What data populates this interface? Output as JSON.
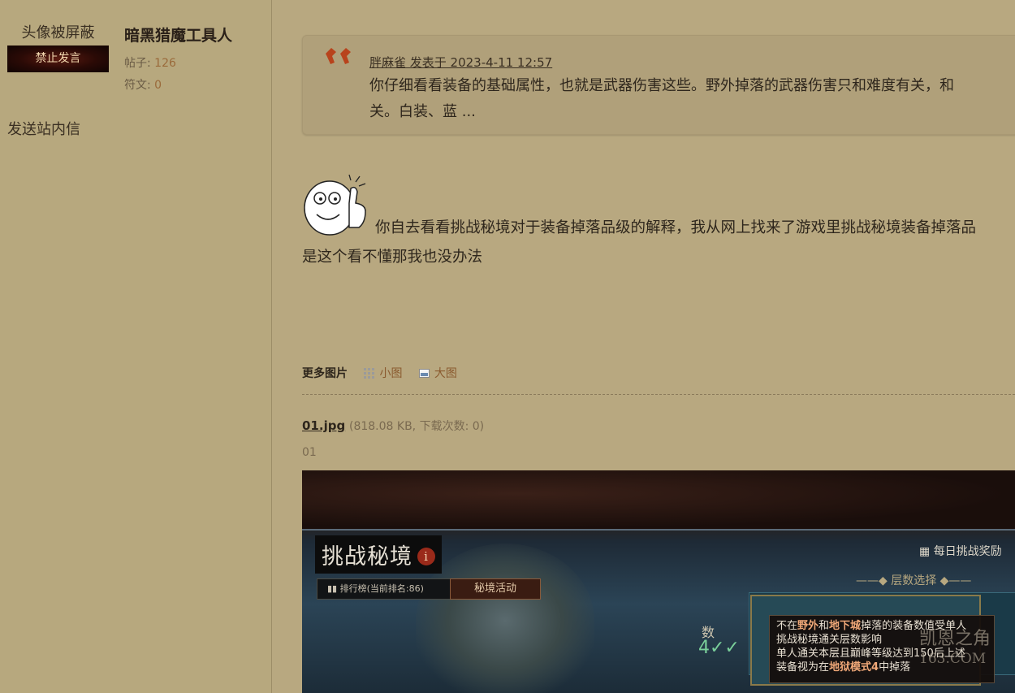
{
  "user": {
    "avatar_text": "头像被屏蔽",
    "ban_badge": "禁止发言",
    "name": "暗黑猎魔工具人",
    "posts_label": "帖子:",
    "posts_value": "126",
    "runes_label": "符文:",
    "runes_value": "0",
    "send_pm": "发送站内信"
  },
  "quote": {
    "meta": "胖麻雀 发表于 2023-4-11 12:57",
    "line1": "你仔细看看装备的基础属性，也就是武器伤害这些。野外掉落的武器伤害只和难度有关，和",
    "line2": "关。白装、蓝 ..."
  },
  "post": {
    "line1": "你自去看看挑战秘境对于装备掉落品级的解释，我从网上找来了游戏里挑战秘境装备掉落品",
    "line2": "是这个看不懂那我也没办法"
  },
  "more_pics": {
    "title": "更多图片",
    "small": "小图",
    "large": "大图"
  },
  "attachment": {
    "file_name": "01.jpg",
    "file_info": "(818.08 KB, 下载次数: 0)",
    "caption": "01"
  },
  "screenshot": {
    "title": "挑战秘境",
    "info_glyph": "i",
    "rank_label": "排行榜(当前排名:86)",
    "activity_label": "秘境活动",
    "daily_reward": "每日挑战奖励",
    "floor_select": "层数选择",
    "left_label": "数",
    "big_num": "4",
    "tooltip_line1_pre": "不在",
    "tooltip_line1_b1": "野外",
    "tooltip_line1_mid": "和",
    "tooltip_line1_b2": "地下城",
    "tooltip_line1_post": "掉落的装备数值受单人",
    "tooltip_line2": "挑战秘境通关层数影响",
    "tooltip_line3": "单人通关本层且巅峰等级达到150后上述",
    "tooltip_line4_pre": "装备视为在",
    "tooltip_line4_b": "地狱模式4",
    "tooltip_line4_post": "中掉落",
    "watermark_top": "凯恩之角",
    "watermark_bottom": "163.COM"
  },
  "colors": {
    "page_bg": "#b8a880",
    "link_brown": "#8a5a2e",
    "quote_icon": "#b8431c"
  }
}
